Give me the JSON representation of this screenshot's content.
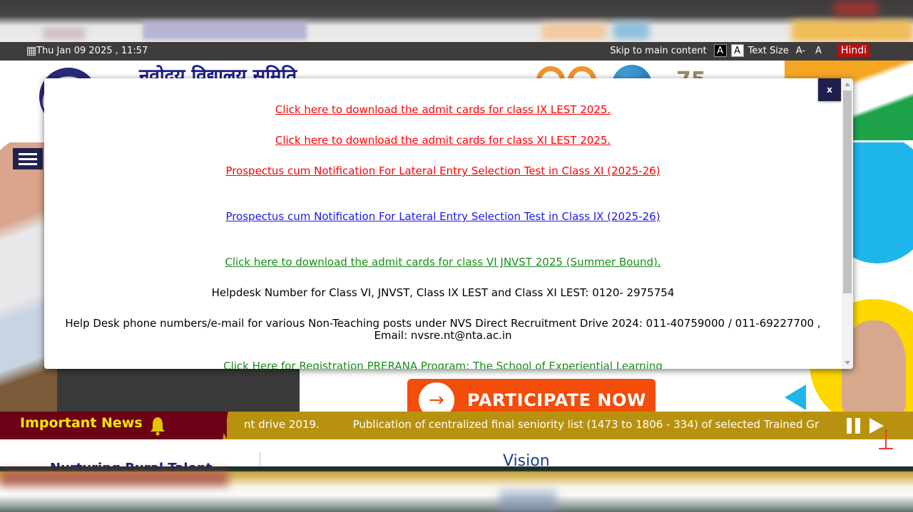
{
  "topbar": {
    "datetime": "Thu Jan 09 2025 , 11:57",
    "skip_link": "Skip to main content",
    "contrast_dark": "A",
    "contrast_light": "A",
    "text_size_label": "Text Size",
    "text_size_decrease": "A-",
    "text_size_normal": "A",
    "language_button": "Hindi"
  },
  "header": {
    "site_title": "नवोदय विद्यालय समिति",
    "badge_75": "75"
  },
  "hero": {
    "participate_label": "PARTICIPATE NOW",
    "participate_arrow": "→"
  },
  "modal": {
    "close_label": "x",
    "items": [
      {
        "text": "Click here to download the admit cards for class IX LEST 2025.",
        "type": "link",
        "color": "#ff0000"
      },
      {
        "text": "Click here to download the admit cards for class XI LEST 2025.",
        "type": "link",
        "color": "#ff0000"
      },
      {
        "text": "Prospectus cum Notification For Lateral Entry Selection Test in Class XI (2025-26)",
        "type": "link",
        "color": "#ff0000"
      },
      {
        "text": "Prospectus cum Notification For Lateral Entry Selection Test in Class IX (2025-26)",
        "type": "link",
        "color": "#1a1aee"
      },
      {
        "text": "Click here to download the admit cards for class VI JNVST 2025 (Summer Bound).",
        "type": "link",
        "color": "#1a8c1a"
      },
      {
        "text": "Helpdesk Number for Class VI, JNVST, Class IX LEST and Class XI LEST: 0120- 2975754",
        "type": "text",
        "color": "#000000"
      },
      {
        "text": "Help Desk phone numbers/e-mail for various Non-Teaching posts under NVS Direct Recruitment Drive 2024: 011-40759000 / 011-69227700 , Email: nvsre.nt@nta.ac.in",
        "type": "text",
        "color": "#000000"
      },
      {
        "text": "Click Here for Registration PRERANA Program: The School of Experiential Learning",
        "type": "link",
        "color": "#1a8c1a"
      }
    ]
  },
  "news": {
    "label": "Important News",
    "ticker_items": [
      "nt drive 2019.",
      "Publication of centralized final seniority list (1473 to 1806 - 334) of selected Trained Gr"
    ]
  },
  "below": {
    "left_heading": "Nurturing Rural Talent",
    "vision_heading": "Vision"
  },
  "colors": {
    "topbar_bg": "#3f3c3c",
    "hindi_bg": "#b80f0f",
    "news_label_bg": "#6b0017",
    "news_label_text": "#ffe600",
    "news_ticker_bg": "#b8920e",
    "modal_close_bg": "#1f1f4f",
    "participate_bg": "#f24d0a"
  }
}
